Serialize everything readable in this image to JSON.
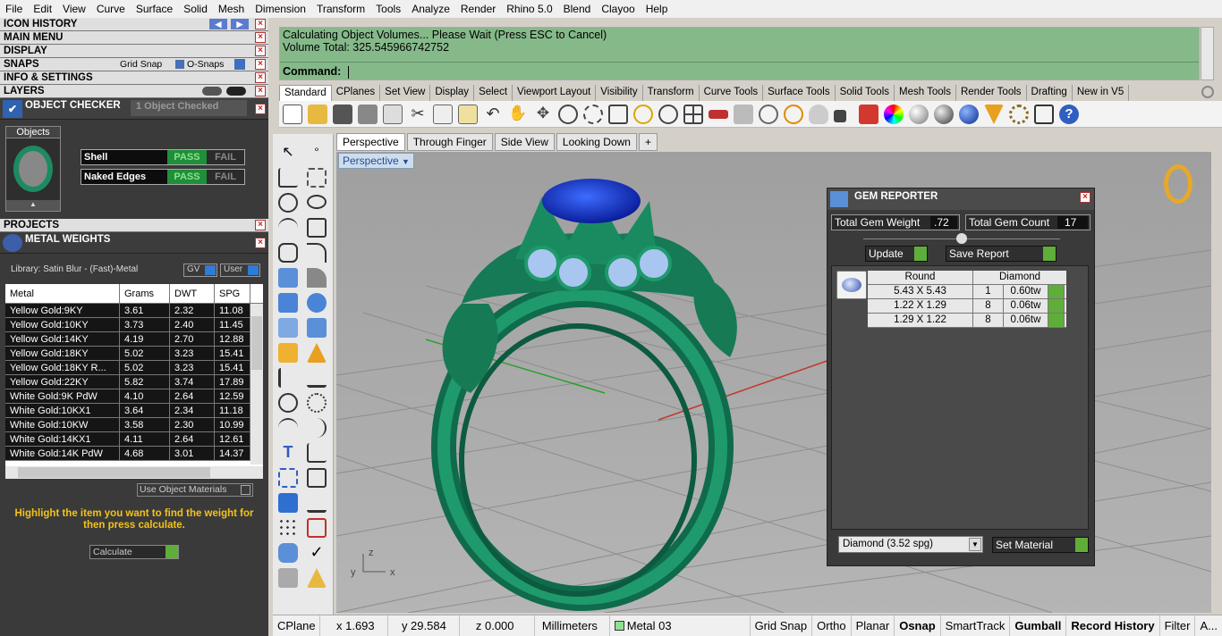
{
  "menu": [
    "File",
    "Edit",
    "View",
    "Curve",
    "Surface",
    "Solid",
    "Mesh",
    "Dimension",
    "Transform",
    "Tools",
    "Analyze",
    "Render",
    "Rhino 5.0",
    "Blend",
    "Clayoo",
    "Help"
  ],
  "panels": {
    "icon_history": "ICON HISTORY",
    "main_menu": "MAIN MENU",
    "display": "DISPLAY",
    "snaps": "SNAPS",
    "grid_snap": "Grid Snap",
    "osnaps": "O-Snaps",
    "info": "INFO & SETTINGS",
    "layers": "LAYERS"
  },
  "checker": {
    "title": "OBJECT CHECKER",
    "count": "1  Object Checked",
    "objects_tab": "Objects",
    "rows": [
      {
        "label": "Shell",
        "pass": "PASS",
        "fail": "FAIL"
      },
      {
        "label": "Naked Edges",
        "pass": "PASS",
        "fail": "FAIL"
      }
    ]
  },
  "projects": "PROJECTS",
  "metal": {
    "title": "METAL WEIGHTS",
    "library": "Library: Satin Blur - (Fast)-Metal",
    "gv": "GV",
    "user": "User",
    "headers": [
      "Metal",
      "Grams",
      "DWT",
      "SPG"
    ],
    "rows": [
      [
        "Yellow Gold:9KY",
        "3.61",
        "2.32",
        "11.08"
      ],
      [
        "Yellow Gold:10KY",
        "3.73",
        "2.40",
        "11.45"
      ],
      [
        "Yellow Gold:14KY",
        "4.19",
        "2.70",
        "12.88"
      ],
      [
        "Yellow Gold:18KY",
        "5.02",
        "3.23",
        "15.41"
      ],
      [
        "Yellow Gold:18KY R...",
        "5.02",
        "3.23",
        "15.41"
      ],
      [
        "Yellow Gold:22KY",
        "5.82",
        "3.74",
        "17.89"
      ],
      [
        "White Gold:9K PdW",
        "4.10",
        "2.64",
        "12.59"
      ],
      [
        "White Gold:10KX1",
        "3.64",
        "2.34",
        "11.18"
      ],
      [
        "White Gold:10KW",
        "3.58",
        "2.30",
        "10.99"
      ],
      [
        "White Gold:14KX1",
        "4.11",
        "2.64",
        "12.61"
      ],
      [
        "White Gold:14K PdW",
        "4.68",
        "3.01",
        "14.37"
      ]
    ],
    "use_materials": "Use Object Materials",
    "hint": "Highlight the item you want to find the weight for then press calculate.",
    "calculate": "Calculate"
  },
  "command": {
    "line1": "Calculating Object Volumes... Please Wait (Press ESC to Cancel)",
    "line2": "Volume Total: 325.545966742752",
    "prompt": "Command:"
  },
  "toolbar_tabs": [
    "Standard",
    "CPlanes",
    "Set View",
    "Display",
    "Select",
    "Viewport Layout",
    "Visibility",
    "Transform",
    "Curve Tools",
    "Surface Tools",
    "Solid Tools",
    "Mesh Tools",
    "Render Tools",
    "Drafting",
    "New in V5"
  ],
  "viewport_tabs": [
    "Perspective",
    "Through Finger",
    "Side View",
    "Looking Down",
    "+"
  ],
  "viewport_label": "Perspective",
  "axis": {
    "z": "z",
    "y": "y",
    "x": "x"
  },
  "gem": {
    "title": "GEM REPORTER",
    "weight_label": "Total Gem Weight",
    "weight": ".72",
    "count_label": "Total Gem Count",
    "count": "17",
    "update": "Update",
    "save": "Save Report",
    "col1": "Round",
    "col2": "Diamond",
    "rows": [
      [
        "5.43 X 5.43",
        "1",
        "0.60tw"
      ],
      [
        "1.22 X 1.29",
        "8",
        "0.06tw"
      ],
      [
        "1.29 X 1.22",
        "8",
        "0.06tw"
      ]
    ],
    "material": "Diamond     (3.52 spg)",
    "set_material": "Set Material"
  },
  "status": {
    "cplane": "CPlane",
    "x": "x 1.693",
    "y": "y 29.584",
    "z": "z 0.000",
    "units": "Millimeters",
    "layer": "Metal 03",
    "grid": "Grid Snap",
    "ortho": "Ortho",
    "planar": "Planar",
    "osnap": "Osnap",
    "smarttrack": "SmartTrack",
    "gumball": "Gumball",
    "history": "Record History",
    "filter": "Filter",
    "more": "A..."
  }
}
